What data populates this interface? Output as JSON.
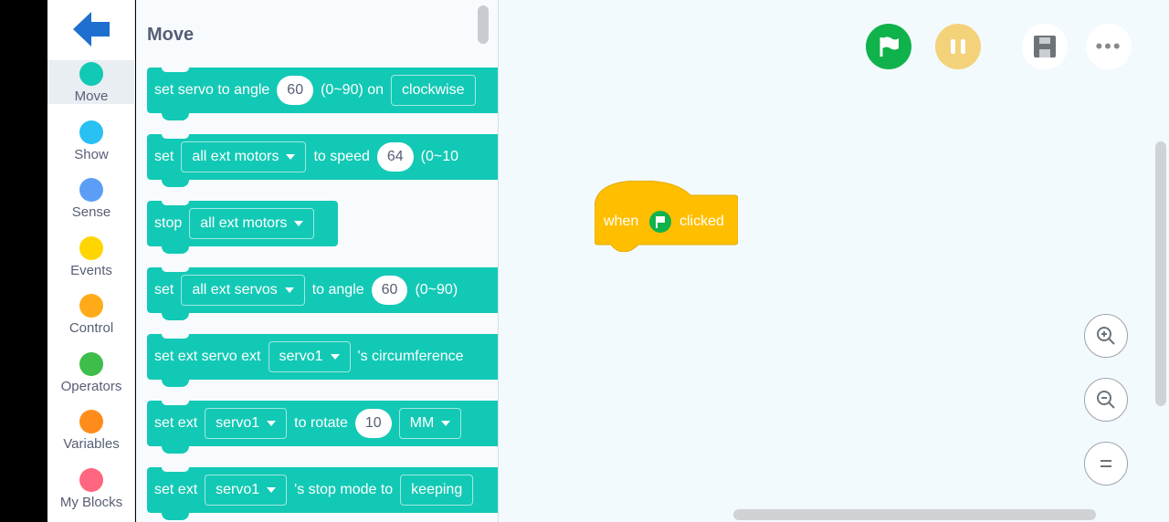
{
  "sidebar": {
    "categories": [
      {
        "label": "Move",
        "color": "#12c9b5",
        "selected": true
      },
      {
        "label": "Show",
        "color": "#29c0f4"
      },
      {
        "label": "Sense",
        "color": "#5c9ef5"
      },
      {
        "label": "Events",
        "color": "#ffd500"
      },
      {
        "label": "Control",
        "color": "#ffab19"
      },
      {
        "label": "Operators",
        "color": "#3fbd4a"
      },
      {
        "label": "Variables",
        "color": "#ff8c1a"
      },
      {
        "label": "My Blocks",
        "color": "#ff6680"
      }
    ]
  },
  "palette": {
    "title": "Move",
    "blocks": [
      {
        "parts": [
          {
            "t": "text",
            "v": "set servo to angle"
          },
          {
            "t": "num",
            "v": "60"
          },
          {
            "t": "text",
            "v": "(0~90) on"
          },
          {
            "t": "dd",
            "v": "clockwise"
          }
        ]
      },
      {
        "parts": [
          {
            "t": "text",
            "v": "set"
          },
          {
            "t": "dd",
            "v": "all ext motors"
          },
          {
            "t": "text",
            "v": "to speed"
          },
          {
            "t": "num",
            "v": "64"
          },
          {
            "t": "text",
            "v": "(0~10"
          }
        ]
      },
      {
        "parts": [
          {
            "t": "text",
            "v": "stop"
          },
          {
            "t": "dd",
            "v": "all ext motors"
          }
        ]
      },
      {
        "parts": [
          {
            "t": "text",
            "v": "set"
          },
          {
            "t": "dd",
            "v": "all ext servos"
          },
          {
            "t": "text",
            "v": "to angle"
          },
          {
            "t": "num",
            "v": "60"
          },
          {
            "t": "text",
            "v": "(0~90)"
          }
        ]
      },
      {
        "parts": [
          {
            "t": "text",
            "v": "set ext servo  ext"
          },
          {
            "t": "dd",
            "v": "servo1"
          },
          {
            "t": "text",
            "v": "'s circumference"
          }
        ]
      },
      {
        "parts": [
          {
            "t": "text",
            "v": "set  ext"
          },
          {
            "t": "dd",
            "v": "servo1"
          },
          {
            "t": "text",
            "v": "to rotate"
          },
          {
            "t": "num",
            "v": "10"
          },
          {
            "t": "dd",
            "v": "MM"
          }
        ]
      },
      {
        "parts": [
          {
            "t": "text",
            "v": "set  ext"
          },
          {
            "t": "dd",
            "v": "servo1"
          },
          {
            "t": "text",
            "v": "'s stop mode to"
          },
          {
            "t": "dd",
            "v": "keeping"
          }
        ]
      }
    ]
  },
  "workspace": {
    "hat_block": {
      "when": "when",
      "clicked": "clicked"
    }
  },
  "icons": {
    "back": "arrow-left-icon",
    "run": "green-flag-icon",
    "pause": "pause-icon",
    "save": "floppy-disk-icon",
    "more": "more-dots-icon",
    "zoom_in": "zoom-in-icon",
    "zoom_out": "zoom-out-icon",
    "reset": "equals-icon"
  }
}
